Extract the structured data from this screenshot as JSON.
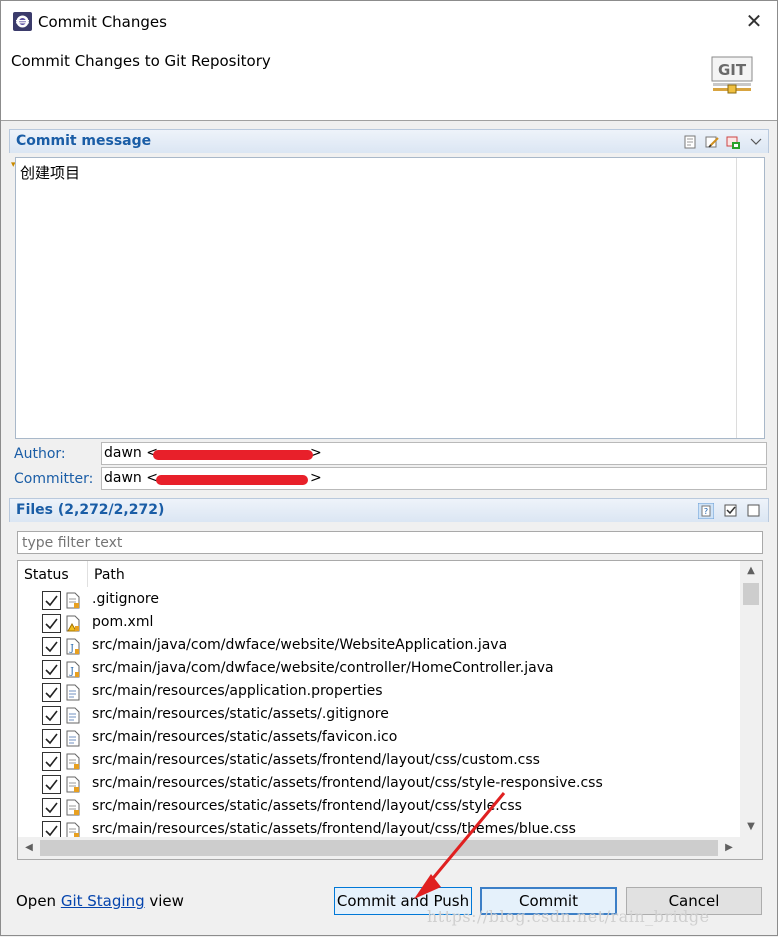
{
  "window": {
    "title": "Commit Changes",
    "header": "Commit Changes to Git Repository",
    "git_logo_text": "GIT"
  },
  "commit_message": {
    "section_label": "Commit message",
    "text": "创建项目"
  },
  "author": {
    "label": "Author:",
    "value_visible": "dawn <",
    "value_tail": ">"
  },
  "committer": {
    "label": "Committer:",
    "value_visible": "dawn <",
    "value_tail": ">"
  },
  "files": {
    "section_label": "Files (2,272/2,272)",
    "filter_placeholder": "type filter text",
    "columns": [
      "Status",
      "Path"
    ],
    "rows": [
      {
        "path": ".gitignore",
        "checked": true,
        "icon": "modified-file-icon"
      },
      {
        "path": "pom.xml",
        "checked": true,
        "icon": "xml-warning-file-icon"
      },
      {
        "path": "src/main/java/com/dwface/website/WebsiteApplication.java",
        "checked": true,
        "icon": "java-file-icon"
      },
      {
        "path": "src/main/java/com/dwface/website/controller/HomeController.java",
        "checked": true,
        "icon": "java-file-icon"
      },
      {
        "path": "src/main/resources/application.properties",
        "checked": true,
        "icon": "text-file-icon"
      },
      {
        "path": "src/main/resources/static/assets/.gitignore",
        "checked": true,
        "icon": "text-file-icon"
      },
      {
        "path": "src/main/resources/static/assets/favicon.ico",
        "checked": true,
        "icon": "text-file-icon"
      },
      {
        "path": "src/main/resources/static/assets/frontend/layout/css/custom.css",
        "checked": true,
        "icon": "css-file-icon"
      },
      {
        "path": "src/main/resources/static/assets/frontend/layout/css/style-responsive.css",
        "checked": true,
        "icon": "css-file-icon"
      },
      {
        "path": "src/main/resources/static/assets/frontend/layout/css/style.css",
        "checked": true,
        "icon": "css-file-icon"
      },
      {
        "path": "src/main/resources/static/assets/frontend/layout/css/themes/blue.css",
        "checked": true,
        "icon": "css-file-icon"
      }
    ]
  },
  "footer": {
    "open_prefix": "Open ",
    "link": "Git Staging",
    "open_suffix": " view",
    "commit_and_push": "Commit and Push",
    "commit": "Commit",
    "cancel": "Cancel"
  },
  "watermark": "https://blog.csdn.net/rain_bridge",
  "colors": {
    "section_label": "#1a5da6",
    "redaction": "#e8202a",
    "annotation_arrow": "#e02020"
  }
}
